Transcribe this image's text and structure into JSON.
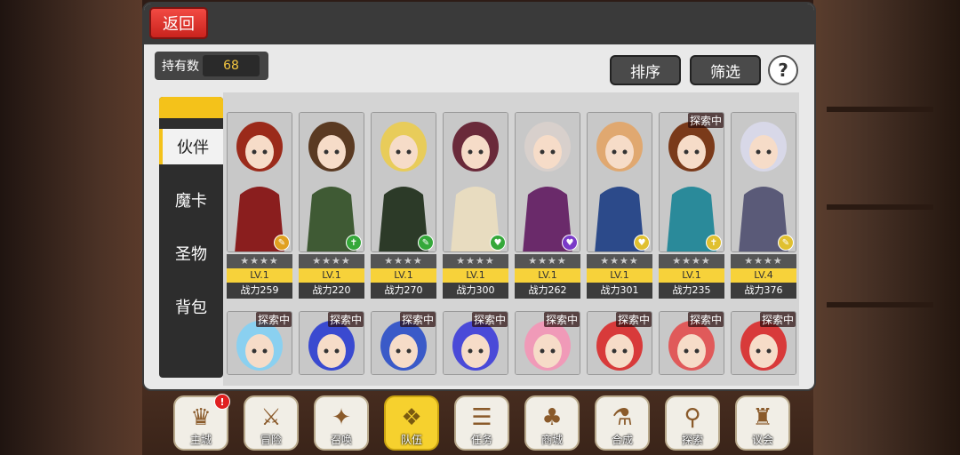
{
  "header": {
    "back_label": "返回"
  },
  "owned": {
    "label": "持有数",
    "value": "68"
  },
  "toolbar": {
    "sort_label": "排序",
    "filter_label": "筛选",
    "help_label": "?"
  },
  "sidebar": {
    "items": [
      {
        "label": "伙伴",
        "active": true
      },
      {
        "label": "魔卡",
        "active": false
      },
      {
        "label": "圣物",
        "active": false
      },
      {
        "label": "背包",
        "active": false
      }
    ]
  },
  "cards_row1": [
    {
      "stars": "★★★★",
      "level": "LV.1",
      "power": "战力259",
      "explore": "",
      "hair": "#9b2a1a",
      "outfit": "#8a1e1e",
      "elem_color": "#e0a020",
      "elem_icon": "✎"
    },
    {
      "stars": "★★★★",
      "level": "LV.1",
      "power": "战力220",
      "explore": "",
      "hair": "#5a3a22",
      "outfit": "#3f5a34",
      "elem_color": "#35a83a",
      "elem_icon": "✝"
    },
    {
      "stars": "★★★★",
      "level": "LV.1",
      "power": "战力270",
      "explore": "",
      "hair": "#e8cc5a",
      "outfit": "#2c3a28",
      "elem_color": "#35a83a",
      "elem_icon": "✎"
    },
    {
      "stars": "★★★★",
      "level": "LV.1",
      "power": "战力300",
      "explore": "",
      "hair": "#6a2a3a",
      "outfit": "#e8dcc0",
      "elem_color": "#35a83a",
      "elem_icon": "♥"
    },
    {
      "stars": "★★★★",
      "level": "LV.1",
      "power": "战力262",
      "explore": "",
      "hair": "#d8d0cc",
      "outfit": "#6a2a6a",
      "elem_color": "#7a3ac8",
      "elem_icon": "♥"
    },
    {
      "stars": "★★★★",
      "level": "LV.1",
      "power": "战力301",
      "explore": "",
      "hair": "#e0a870",
      "outfit": "#2c4a8a",
      "elem_color": "#e0c030",
      "elem_icon": "♥"
    },
    {
      "stars": "★★★★",
      "level": "LV.1",
      "power": "战力235",
      "explore": "探索中",
      "hair": "#7a3a1a",
      "outfit": "#2a8a9a",
      "elem_color": "#e0c030",
      "elem_icon": "✝"
    },
    {
      "stars": "★★★★",
      "level": "LV.4",
      "power": "战力376",
      "explore": "",
      "hair": "#d8d8e8",
      "outfit": "#5a5a78",
      "elem_color": "#e0c030",
      "elem_icon": "✎"
    }
  ],
  "cards_row2": [
    {
      "explore": "探索中",
      "hair": "#8ad0f0"
    },
    {
      "explore": "探索中",
      "hair": "#3a4ad0"
    },
    {
      "explore": "探索中",
      "hair": "#3a5ac8"
    },
    {
      "explore": "探索中",
      "hair": "#4a4ad8"
    },
    {
      "explore": "探索中",
      "hair": "#f09ab8"
    },
    {
      "explore": "探索中",
      "hair": "#d83a3a"
    },
    {
      "explore": "探索中",
      "hair": "#e05a5a"
    },
    {
      "explore": "探索中",
      "hair": "#d83a3a"
    }
  ],
  "bottom_nav": [
    {
      "label": "主城",
      "icon": "♛",
      "active": false,
      "badge": "!"
    },
    {
      "label": "冒险",
      "icon": "⚔",
      "active": false,
      "badge": ""
    },
    {
      "label": "召唤",
      "icon": "✦",
      "active": false,
      "badge": ""
    },
    {
      "label": "队伍",
      "icon": "❖",
      "active": true,
      "badge": ""
    },
    {
      "label": "任务",
      "icon": "☰",
      "active": false,
      "badge": ""
    },
    {
      "label": "商城",
      "icon": "♣",
      "active": false,
      "badge": ""
    },
    {
      "label": "合成",
      "icon": "⚗",
      "active": false,
      "badge": ""
    },
    {
      "label": "探索",
      "icon": "⚲",
      "active": false,
      "badge": ""
    },
    {
      "label": "议会",
      "icon": "♜",
      "active": false,
      "badge": ""
    }
  ]
}
